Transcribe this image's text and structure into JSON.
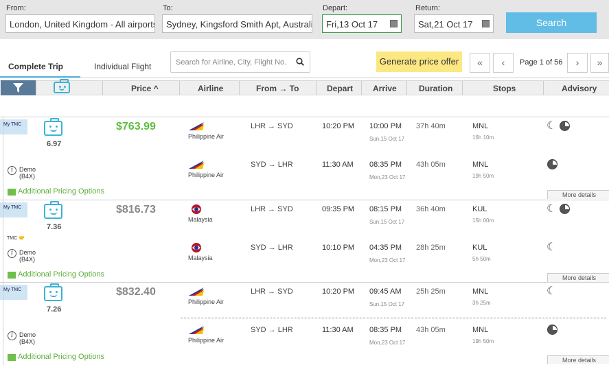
{
  "search": {
    "from_label": "From:",
    "from_value": "London, United Kingdom - All airports",
    "to_label": "To:",
    "to_value": "Sydney, Kingsford Smith Apt, Australia",
    "depart_label": "Depart:",
    "depart_value": "Fri,13 Oct 17",
    "return_label": "Return:",
    "return_value": "Sat,21 Oct 17",
    "search_button": "Search"
  },
  "tabs": {
    "complete": "Complete Trip",
    "individual": "Individual Flight"
  },
  "filter": {
    "placeholder": "Search for Airline, City, Flight No."
  },
  "toolbar": {
    "generate_offer": "Generate price offer"
  },
  "pager": {
    "first": "«",
    "prev": "‹",
    "text": "Page 1 of 56",
    "next": "›",
    "last": "»"
  },
  "columns": {
    "price": "Price ^",
    "airline": "Airline",
    "fromto": "From → To",
    "depart": "Depart",
    "arrive": "Arrive",
    "duration": "Duration",
    "stops": "Stops",
    "advisory": "Advisory"
  },
  "labels": {
    "mytmc": "My TMC",
    "additional": "Additional Pricing Options",
    "more": "More details",
    "demo": "Demo",
    "demo_code": "(B4X)",
    "tmc": "TMC"
  },
  "results": [
    {
      "price": "$763.99",
      "score": "6.97",
      "out": {
        "airline": "Philippine Air",
        "route": "LHR → SYD",
        "depart": "10:20 PM",
        "arrive": "10:00 PM",
        "arrive_date": "Sun,15 Oct 17",
        "duration": "37h 40m",
        "stop": "MNL",
        "stop_time": "16h 10m"
      },
      "ret": {
        "airline": "Philippine Air",
        "route": "SYD → LHR",
        "depart": "11:30 AM",
        "arrive": "08:35 PM",
        "arrive_date": "Mon,23 Oct 17",
        "duration": "43h 05m",
        "stop": "MNL",
        "stop_time": "19h 50m"
      }
    },
    {
      "price": "$816.73",
      "score": "7.36",
      "out": {
        "airline": "Malaysia",
        "route": "LHR → SYD",
        "depart": "09:35 PM",
        "arrive": "08:15 PM",
        "arrive_date": "Sun,15 Oct 17",
        "duration": "36h 40m",
        "stop": "KUL",
        "stop_time": "15h 00m"
      },
      "ret": {
        "airline": "Malaysia",
        "route": "SYD → LHR",
        "depart": "10:10 PM",
        "arrive": "04:35 PM",
        "arrive_date": "Mon,23 Oct 17",
        "duration": "28h 25m",
        "stop": "KUL",
        "stop_time": "5h 50m"
      }
    },
    {
      "price": "$832.40",
      "score": "7.26",
      "out": {
        "airline": "Philippine Air",
        "route": "LHR → SYD",
        "depart": "10:20 PM",
        "arrive": "09:45 AM",
        "arrive_date": "Sun,15 Oct 17",
        "duration": "25h 25m",
        "stop": "MNL",
        "stop_time": "3h 25m"
      },
      "ret": {
        "airline": "Philippine Air",
        "route": "SYD → LHR",
        "depart": "11:30 AM",
        "arrive": "08:35 PM",
        "arrive_date": "Mon,23 Oct 17",
        "duration": "43h 05m",
        "stop": "MNL",
        "stop_time": "19h 50m"
      }
    }
  ]
}
